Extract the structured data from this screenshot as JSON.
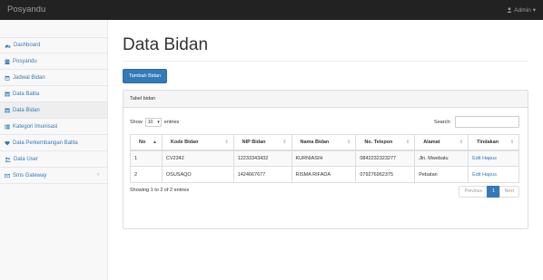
{
  "app": {
    "brand": "Posyandu",
    "user_menu": "Admin"
  },
  "sidebar": {
    "items": [
      {
        "label": "Dashboard",
        "icon": "dashboard-icon"
      },
      {
        "label": "Posyandu",
        "icon": "building-icon"
      },
      {
        "label": "Jadwal Bidan",
        "icon": "calendar-icon"
      },
      {
        "label": "Data Balita",
        "icon": "table-icon"
      },
      {
        "label": "Data Bidan",
        "icon": "table-icon"
      },
      {
        "label": "Kategori Imunisasi",
        "icon": "list-icon"
      },
      {
        "label": "Data Perkembangan Balita",
        "icon": "heart-icon"
      },
      {
        "label": "Data User",
        "icon": "users-icon"
      },
      {
        "label": "Sms Gateway",
        "icon": "envelope-icon",
        "arrow": "‹"
      }
    ],
    "active_index": 4
  },
  "page": {
    "title": "Data Bidan",
    "add_button": "Tambah Bidan",
    "panel_title": "Tabel bidan",
    "show_label": "Show",
    "page_length": "10",
    "entries_label": "entries",
    "search_label": "Search:",
    "search_value": ""
  },
  "table": {
    "columns": [
      "No",
      "Kode Bidan",
      "NIP Bidan",
      "Nama Bidan",
      "No. Telepon",
      "Alamat",
      "Tindakan"
    ],
    "rows": [
      {
        "no": "1",
        "kode": "CV2342",
        "nip": "12233343432",
        "nama": "KURNIASIH",
        "telp": "0842232323277",
        "alamat": "Jln. Mwebatu",
        "edit": "Edit",
        "hapus": "Hapus"
      },
      {
        "no": "2",
        "kode": "OSUSAQO",
        "nip": "1424667677",
        "nama": "RISMA RIFADA",
        "telp": "079276962375",
        "alamat": "Pebatan",
        "edit": "Edit",
        "hapus": "Hapus"
      }
    ]
  },
  "footer": {
    "info": "Showing 1 to 2 of 2 entries",
    "previous": "Previous",
    "current_page": "1",
    "next": "Next"
  },
  "colors": {
    "accent": "#337ab7",
    "navbar": "#222222"
  }
}
